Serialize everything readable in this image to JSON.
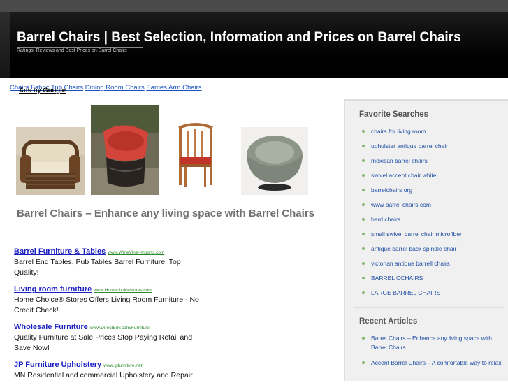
{
  "header": {
    "site_title": "Barrel Chairs | Best Selection, Information and Prices on Barrel Chairs",
    "tagline": "Ratings, Reviews and Best Prices on Barrel Chairs"
  },
  "ad_links_bar": {
    "label": "Ads by Google",
    "links": [
      "Chairs",
      "Fabric Tub Chairs",
      "Dining Room Chairs",
      "Eames Arm Chairs"
    ]
  },
  "post": {
    "heading": "Barrel Chairs – Enhance any living space with Barrel Chairs"
  },
  "ads": [
    {
      "title": "Barrel Furniture & Tables",
      "url": "www.WineVine-Imports.com",
      "desc": "Barrel End Tables, Pub Tables Barrel Furniture, Top Quality!"
    },
    {
      "title": "Living room furniture",
      "url": "www.Homechoicestores.com",
      "desc": "Home Choice® Stores Offers Living Room Furniture - No Credit Check!"
    },
    {
      "title": "Wholesale Furniture",
      "url": "www.DirectBuy.com/Furniture",
      "desc": "Quality Furniture at Sale Prices Stop Paying Retail and Save Now!"
    },
    {
      "title": "JP Furniture Upholstery",
      "url": "www.jpfurniture.net",
      "desc": "MN Residential and commercial Upholstery and Repair"
    }
  ],
  "sidebar": {
    "favorite_title": "Favorite Searches",
    "favorites": [
      "chairs for living room",
      "upholster antique barrel chair",
      "mexican barrel chairs",
      "swivel accent chair white",
      "barrelchairs org",
      "www barrel chairs com",
      "berrl chairs",
      "small swivel barrel chair microfiber",
      "antique barrel back spindle chair",
      "victorian antique barrell chairs",
      "BARREL CCHAIRS",
      "LARGE BARREL CHAIRS"
    ],
    "recent_title": "Recent Articles",
    "recent": [
      "Barrel Chairs – Enhance any living space with Barrel Chairs",
      "Accent Barrel Chairs – A comfortable way to relax"
    ]
  },
  "colors": {
    "link": "#1a4fc2",
    "ad_url": "#2a8a2a",
    "bullet": "#7fb86b",
    "sidebar_bg": "#f0f0f0"
  }
}
